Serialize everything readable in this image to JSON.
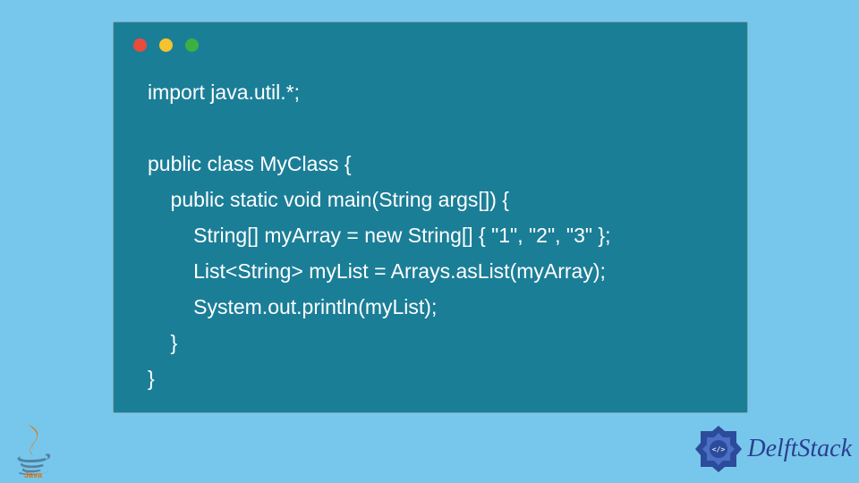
{
  "code": {
    "lines": [
      "import java.util.*;",
      "",
      "public class MyClass {",
      "    public static void main(String args[]) {",
      "        String[] myArray = new String[] { \"1\", \"2\", \"3\" };",
      "        List<String> myList = Arrays.asList(myArray);",
      "        System.out.println(myList);",
      "    }",
      "}"
    ]
  },
  "branding": {
    "java_label": "Java",
    "delft_label": "DelftStack"
  },
  "window": {
    "dots": [
      "red",
      "yellow",
      "green"
    ]
  }
}
